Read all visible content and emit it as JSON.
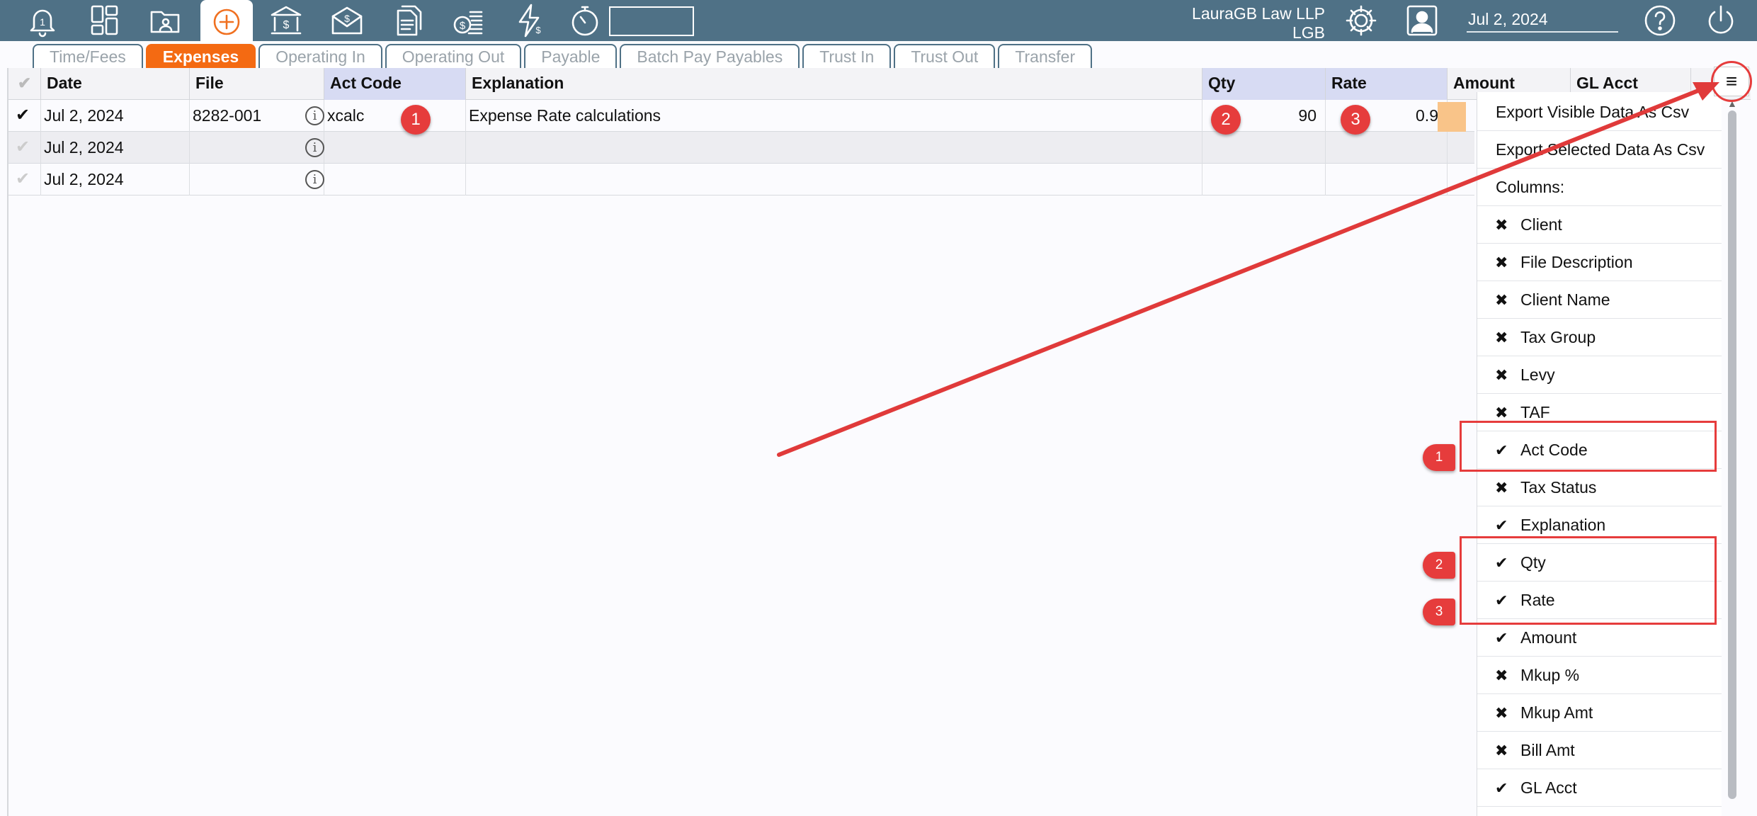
{
  "topbar": {
    "firm_name": "LauraGB Law LLP",
    "firm_code": "LGB",
    "date": "Jul 2, 2024",
    "notification_count": "1",
    "search_value": "",
    "icons": [
      "bell-icon",
      "dashboard-icon",
      "folder-user-icon",
      "add-icon",
      "bank-icon",
      "mail-money-icon",
      "documents-icon",
      "coins-icon",
      "lightning-icon",
      "stopwatch-icon",
      "gear-icon",
      "user-icon",
      "help-icon",
      "power-icon"
    ]
  },
  "tabs": [
    {
      "label": "Time/Fees",
      "active": false
    },
    {
      "label": "Expenses",
      "active": true
    },
    {
      "label": "Operating In",
      "active": false
    },
    {
      "label": "Operating Out",
      "active": false
    },
    {
      "label": "Payable",
      "active": false
    },
    {
      "label": "Batch Pay Payables",
      "active": false
    },
    {
      "label": "Trust In",
      "active": false
    },
    {
      "label": "Trust Out",
      "active": false
    },
    {
      "label": "Transfer",
      "active": false
    }
  ],
  "grid": {
    "headers": {
      "date": "Date",
      "file": "File",
      "act_code": "Act Code",
      "explanation": "Explanation",
      "qty": "Qty",
      "rate": "Rate",
      "amount": "Amount",
      "gl_acct": "GL Acct"
    },
    "rows": [
      {
        "checked": true,
        "date": "Jul 2, 2024",
        "file": "8282-001",
        "act_code": "xcalc",
        "explanation": "Expense Rate calculations",
        "qty": "90",
        "rate": "0.9"
      },
      {
        "checked": false,
        "date": "Jul 2, 2024",
        "file": "",
        "act_code": "",
        "explanation": "",
        "qty": "",
        "rate": ""
      },
      {
        "checked": false,
        "date": "Jul 2, 2024",
        "file": "",
        "act_code": "",
        "explanation": "",
        "qty": "",
        "rate": ""
      }
    ]
  },
  "markers": [
    "1",
    "2",
    "3"
  ],
  "column_menu": {
    "export_visible": "Export Visible Data As Csv",
    "export_selected": "Export Selected Data As Csv",
    "columns_label": "Columns:",
    "items": [
      {
        "label": "Client",
        "visible": false
      },
      {
        "label": "File Description",
        "visible": false
      },
      {
        "label": "Client Name",
        "visible": false
      },
      {
        "label": "Tax Group",
        "visible": false
      },
      {
        "label": "Levy",
        "visible": false
      },
      {
        "label": "TAF",
        "visible": false
      },
      {
        "label": "Act Code",
        "visible": true
      },
      {
        "label": "Tax Status",
        "visible": false
      },
      {
        "label": "Explanation",
        "visible": true
      },
      {
        "label": "Qty",
        "visible": true
      },
      {
        "label": "Rate",
        "visible": true
      },
      {
        "label": "Amount",
        "visible": true
      },
      {
        "label": "Mkup %",
        "visible": false
      },
      {
        "label": "Mkup Amt",
        "visible": false
      },
      {
        "label": "Bill Amt",
        "visible": false
      },
      {
        "label": "GL Acct",
        "visible": true
      }
    ]
  },
  "colors": {
    "topbar": "#4f7186",
    "accent": "#f46a12",
    "annotation": "#e63c3c",
    "header_highlight": "#d7dbf3"
  }
}
